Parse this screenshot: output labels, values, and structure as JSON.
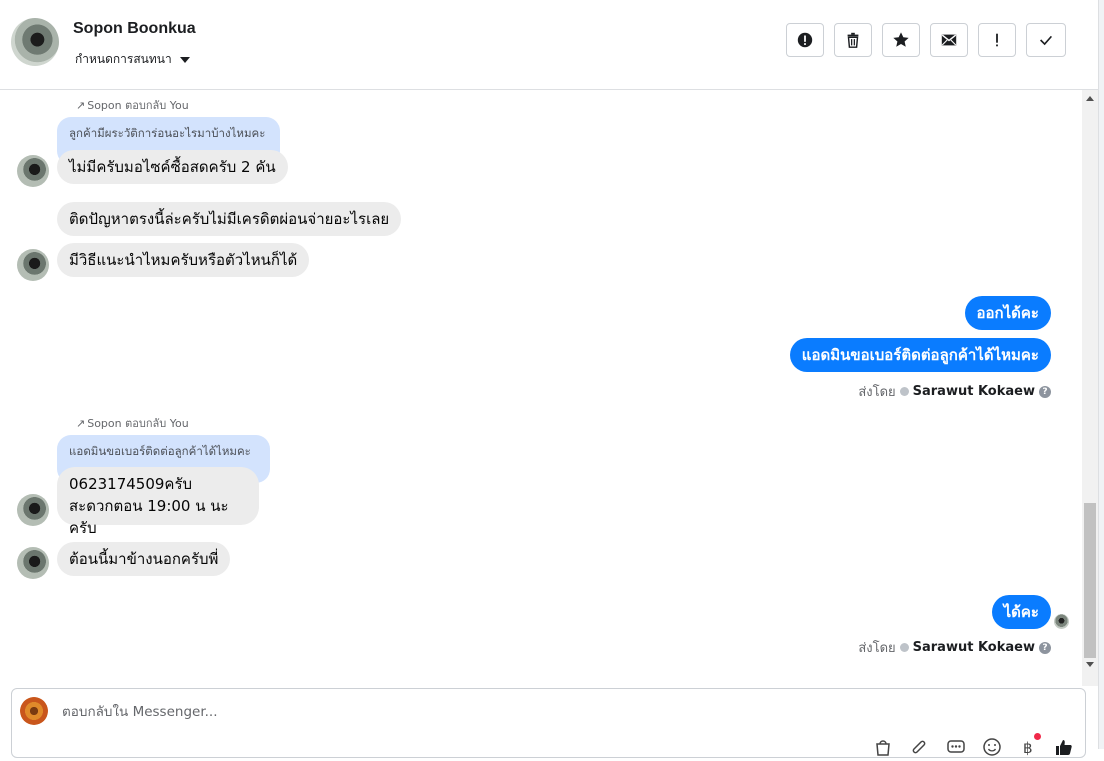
{
  "header": {
    "contact_name": "Sopon Boonkua",
    "assign_label": "กำหนดการสนทนา",
    "toolbar": {
      "spam_icon": "alert-circle-icon",
      "delete_icon": "trash-icon",
      "star_icon": "star-icon",
      "unread_icon": "envelope-icon",
      "important_icon": "exclamation-icon",
      "done_icon": "check-icon"
    }
  },
  "conversation": {
    "reply1": {
      "note": "Sopon ตอบกลับ You",
      "quoted": "ลูกค้ามีผระวัติการ่อนอะไรมาบ้างไหมคะ"
    },
    "msg1": "ไม่มีครับมอไซค์ซื้อสดครับ 2 คัน",
    "msg2": "ติดปัญหาตรงนี้ล่ะครับไม่มีเครดิตผ่อนจ่ายอะไรเลย",
    "msg3": "มีวิธีแนะนำไหมครับหรือตัวไหนก็ได้",
    "out1": "ออกได้คะ",
    "out2": "แอดมินขอเบอร์ติดต่อลูกค้าได้ไหมคะ",
    "sent_by_label": "ส่งโดย",
    "agent_name": "Sarawut Kokaew",
    "reply2": {
      "note": "Sopon ตอบกลับ You",
      "quoted": "แอดมินขอเบอร์ติดต่อลูกค้าได้ไหมคะ"
    },
    "msg4_line1": "0623174509ครับ",
    "msg4_line2": "สะดวกตอน 19:00 น นะครับ",
    "msg5": "ต้อนนี้มาข้างนอกครับพี่",
    "out3": "ได้คะ"
  },
  "composer": {
    "placeholder": "ตอบกลับใน Messenger...",
    "icons": [
      "bag-icon",
      "paperclip-icon",
      "saved-replies-icon",
      "emoji-icon",
      "currency-icon",
      "thumbs-up-icon"
    ]
  },
  "colors": {
    "outgoing": "#0a7cff",
    "incoming": "#ececec",
    "quote": "#d3e3fd"
  }
}
